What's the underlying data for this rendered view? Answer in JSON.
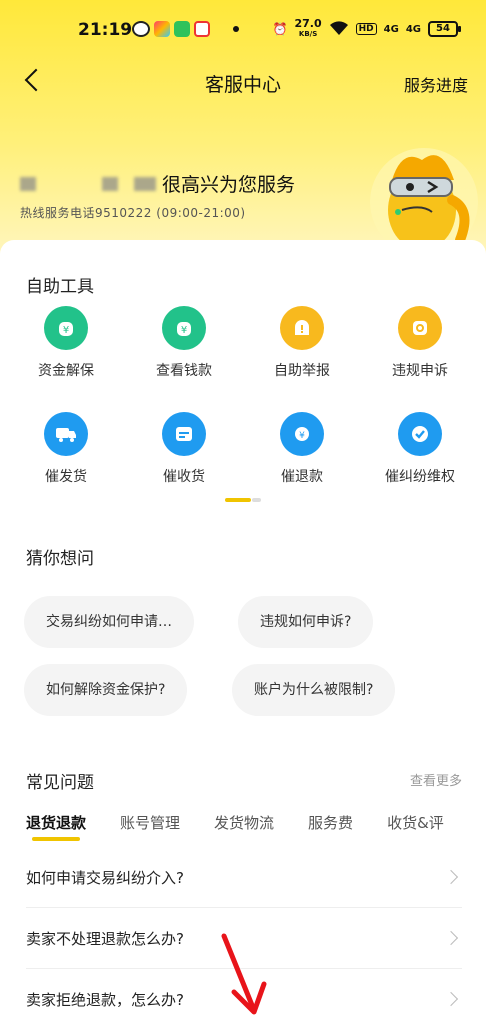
{
  "status_bar": {
    "time": "21:19",
    "speed_value": "27.0",
    "speed_unit": "KB/S",
    "hd_label": "HD",
    "signal1": "4G",
    "signal2": "4G",
    "battery": "54"
  },
  "nav": {
    "title": "客服中心",
    "right_link": "服务进度"
  },
  "banner": {
    "greeting_suffix": "很高兴为您服务",
    "hotline": "热线服务电话9510222 (09:00-21:00)"
  },
  "self_tools": {
    "title": "自助工具",
    "items": [
      {
        "label": "资金解保",
        "icon": "money-bag-icon",
        "color": "#22c28a"
      },
      {
        "label": "查看钱款",
        "icon": "money-search-icon",
        "color": "#22c28a"
      },
      {
        "label": "自助举报",
        "icon": "report-icon",
        "color": "#f8b91e"
      },
      {
        "label": "违规申诉",
        "icon": "appeal-icon",
        "color": "#f8b91e"
      },
      {
        "label": "催发货",
        "icon": "truck-icon",
        "color": "#1f9bf0"
      },
      {
        "label": "催收货",
        "icon": "package-icon",
        "color": "#1f9bf0"
      },
      {
        "label": "催退款",
        "icon": "refund-icon",
        "color": "#1f9bf0"
      },
      {
        "label": "催纠纷维权",
        "icon": "check-shield-icon",
        "color": "#1f9bf0"
      }
    ]
  },
  "guess": {
    "title": "猜你想问",
    "chips": [
      "交易纠纷如何申请…",
      "违规如何申诉?",
      "如何解除资金保护?",
      "账户为什么被限制?"
    ]
  },
  "faq": {
    "title": "常见问题",
    "more": "查看更多",
    "tabs": [
      "退货退款",
      "账号管理",
      "发货物流",
      "服务费",
      "收货&评"
    ],
    "questions": [
      "如何申请交易纠纷介入?",
      "卖家不处理退款怎么办?",
      "卖家拒绝退款，怎么办?"
    ]
  }
}
